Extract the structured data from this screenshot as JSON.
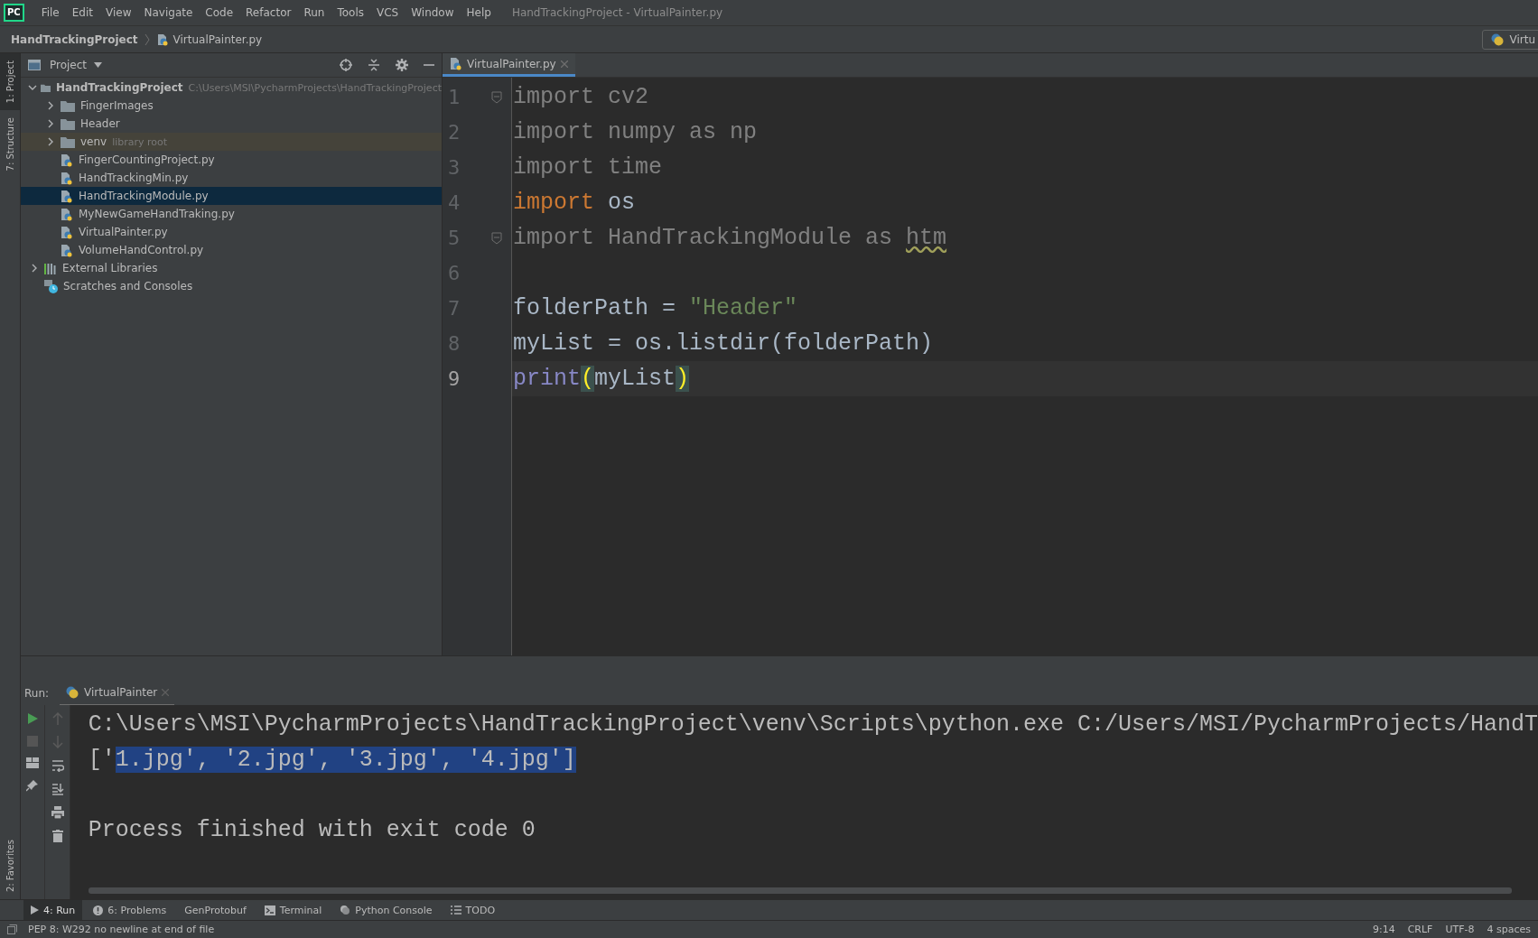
{
  "menu_bar": {
    "logo": "PC",
    "items": [
      "File",
      "Edit",
      "View",
      "Navigate",
      "Code",
      "Refactor",
      "Run",
      "Tools",
      "VCS",
      "Window",
      "Help"
    ],
    "title": "HandTrackingProject - VirtualPainter.py"
  },
  "breadcrumb": {
    "items": [
      {
        "label": "HandTrackingProject",
        "kind": "project"
      },
      {
        "label": "VirtualPainter.py",
        "kind": "python"
      }
    ],
    "run_config": "Virtu"
  },
  "side_strip": {
    "top": [
      {
        "label": "1: Project",
        "selected": true
      },
      {
        "label": "7: Structure",
        "selected": false
      }
    ],
    "bottom": [
      {
        "label": "2: Favorites",
        "selected": false
      }
    ]
  },
  "project_panel": {
    "title": "Project",
    "tree": [
      {
        "label": "HandTrackingProject",
        "hint": "C:\\Users\\MSI\\PycharmProjects\\HandTrackingProject",
        "kind": "project",
        "expanded": true,
        "selected": false,
        "children": [
          {
            "label": "FingerImages",
            "kind": "folder",
            "expanded": false,
            "selected": false
          },
          {
            "label": "Header",
            "kind": "folder",
            "expanded": false,
            "selected": false
          },
          {
            "label": "venv",
            "hint": "library root",
            "kind": "library-folder",
            "expanded": false,
            "selected": false
          },
          {
            "label": "FingerCountingProject.py",
            "kind": "python",
            "selected": false
          },
          {
            "label": "HandTrackingMin.py",
            "kind": "python",
            "selected": false
          },
          {
            "label": "HandTrackingModule.py",
            "kind": "python",
            "selected": true
          },
          {
            "label": "MyNewGameHandTraking.py",
            "kind": "python",
            "selected": false
          },
          {
            "label": "VirtualPainter.py",
            "kind": "python",
            "selected": false
          },
          {
            "label": "VolumeHandControl.py",
            "kind": "python",
            "selected": false
          }
        ]
      },
      {
        "label": "External Libraries",
        "kind": "libraries",
        "expanded": false,
        "selected": false
      },
      {
        "label": "Scratches and Consoles",
        "kind": "scratches",
        "selected": false
      }
    ]
  },
  "editor": {
    "tabs": [
      {
        "label": "VirtualPainter.py",
        "selected": true
      }
    ],
    "lines": [
      {
        "number": "1",
        "current": false,
        "fold": true,
        "tokens": [
          {
            "text": "import cv2",
            "kind": "unused"
          }
        ]
      },
      {
        "number": "2",
        "current": false,
        "fold": false,
        "tokens": [
          {
            "text": "import numpy as np",
            "kind": "unused"
          }
        ]
      },
      {
        "number": "3",
        "current": false,
        "fold": false,
        "tokens": [
          {
            "text": "import time",
            "kind": "unused"
          }
        ]
      },
      {
        "number": "4",
        "current": false,
        "fold": false,
        "tokens": [
          {
            "text": "import",
            "kind": "keyword"
          },
          {
            "text": " os",
            "kind": "text"
          }
        ]
      },
      {
        "number": "5",
        "current": false,
        "fold": true,
        "tokens": [
          {
            "text": "import HandTrackingModule as ",
            "kind": "unused"
          },
          {
            "text": "htm",
            "kind": "unused-warning"
          }
        ]
      },
      {
        "number": "6",
        "current": false,
        "fold": false
      },
      {
        "number": "7",
        "current": false,
        "fold": false,
        "tokens": [
          {
            "text": "folderPath = ",
            "kind": "text"
          },
          {
            "text": "\"Header\"",
            "kind": "string"
          }
        ]
      },
      {
        "number": "8",
        "current": false,
        "fold": false,
        "tokens": [
          {
            "text": "myList = os.listdir(folderPath)",
            "kind": "text"
          }
        ]
      },
      {
        "number": "9",
        "current": true,
        "fold": false,
        "tokens": [
          {
            "text": "print",
            "kind": "builtin"
          },
          {
            "text": "(",
            "kind": "match"
          },
          {
            "text": "myList",
            "kind": "text"
          },
          {
            "text": ")",
            "kind": "match"
          }
        ]
      }
    ]
  },
  "run_panel": {
    "label": "Run:",
    "tabs": [
      {
        "label": "VirtualPainter",
        "selected": true
      }
    ],
    "console": [
      {
        "kind": "line",
        "segments": [
          {
            "text": "C:\\Users\\MSI\\PycharmProjects\\HandTrackingProject\\venv\\Scripts\\python.exe C:/Users/MSI/PycharmProjects/HandT",
            "selected": false
          }
        ]
      },
      {
        "kind": "line",
        "segments": [
          {
            "text": "['",
            "selected": false
          },
          {
            "text": "1.jpg', '2.jpg', '3.jpg', '4.jpg']",
            "selected": true
          }
        ]
      },
      {
        "kind": "blank"
      },
      {
        "kind": "line",
        "segments": [
          {
            "text": "Process finished with exit code 0",
            "selected": false
          }
        ]
      }
    ]
  },
  "tool_tabs": [
    {
      "label": "4: Run",
      "kind": "run",
      "selected": true
    },
    {
      "label": "6: Problems",
      "kind": "problems",
      "selected": false
    },
    {
      "label": "GenProtobuf",
      "kind": "plain",
      "selected": false
    },
    {
      "label": "Terminal",
      "kind": "terminal",
      "selected": false
    },
    {
      "label": "Python Console",
      "kind": "python",
      "selected": false
    },
    {
      "label": "TODO",
      "kind": "todo",
      "selected": false
    }
  ],
  "status_bar": {
    "message": "PEP 8: W292 no newline at end of file",
    "items": [
      "9:14",
      "CRLF",
      "UTF-8",
      "4 spaces"
    ]
  }
}
